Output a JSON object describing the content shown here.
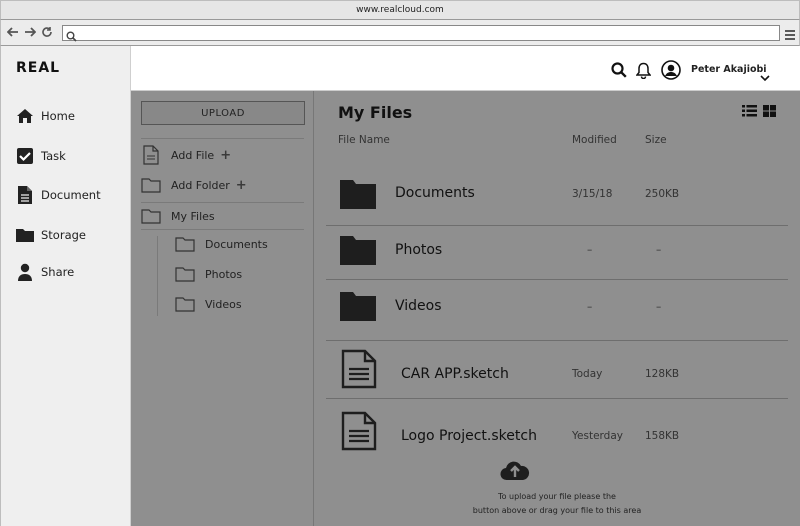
{
  "browser": {
    "url": "www.realcloud.com"
  },
  "sidebar": {
    "brand": "REAL",
    "items": [
      {
        "label": "Home"
      },
      {
        "label": "Task"
      },
      {
        "label": "Document"
      },
      {
        "label": "Storage"
      },
      {
        "label": "Share"
      }
    ]
  },
  "header": {
    "user_name": "Peter Akajiobi"
  },
  "tree": {
    "upload_label": "UPLOAD",
    "add_file": "Add File",
    "add_folder": "Add Folder",
    "my_files": "My Files",
    "children": [
      "Documents",
      "Photos",
      "Videos"
    ]
  },
  "main": {
    "title": "My Files",
    "columns": {
      "name": "File Name",
      "modified": "Modified",
      "size": "Size"
    },
    "files": [
      {
        "type": "folder",
        "name": "Documents",
        "modified": "3/15/18",
        "size": "250KB"
      },
      {
        "type": "folder",
        "name": "Photos",
        "modified": "–",
        "size": "–"
      },
      {
        "type": "folder",
        "name": "Videos",
        "modified": "–",
        "size": "–"
      },
      {
        "type": "file",
        "name": "CAR APP.sketch",
        "modified": "Today",
        "size": "128KB"
      },
      {
        "type": "file",
        "name": "Logo Project.sketch",
        "modified": "Yesterday",
        "size": "158KB"
      }
    ],
    "upload_hint_line1": "To upload your file please the",
    "upload_hint_line2": "button above or drag your file to this area"
  }
}
